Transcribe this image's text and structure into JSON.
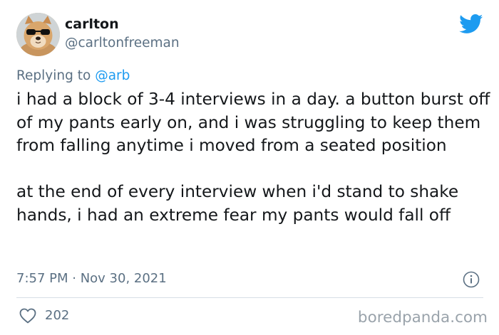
{
  "tweet": {
    "display_name": "carlton",
    "handle": "@carltonfreeman",
    "replying_prefix": "Replying to",
    "replying_to": "@arb",
    "paragraph_1": "i had a block of 3-4 interviews in a day. a button burst off of my pants early on, and i was struggling to keep them from falling anytime i moved from a seated position",
    "paragraph_2": "at the end of every interview when i'd stand to shake hands, i had an extreme fear my pants would fall off",
    "timestamp": "7:57 PM · Nov 30, 2021",
    "like_count": "202"
  },
  "icons": {
    "brand": "twitter-bird-icon",
    "info": "info-icon",
    "like": "heart-icon"
  },
  "watermark": "boredpanda.com",
  "colors": {
    "accent": "#1d9bf0",
    "secondary_text": "#5b7083",
    "primary_text": "#14171a",
    "watermark": "#9aa3ab"
  }
}
